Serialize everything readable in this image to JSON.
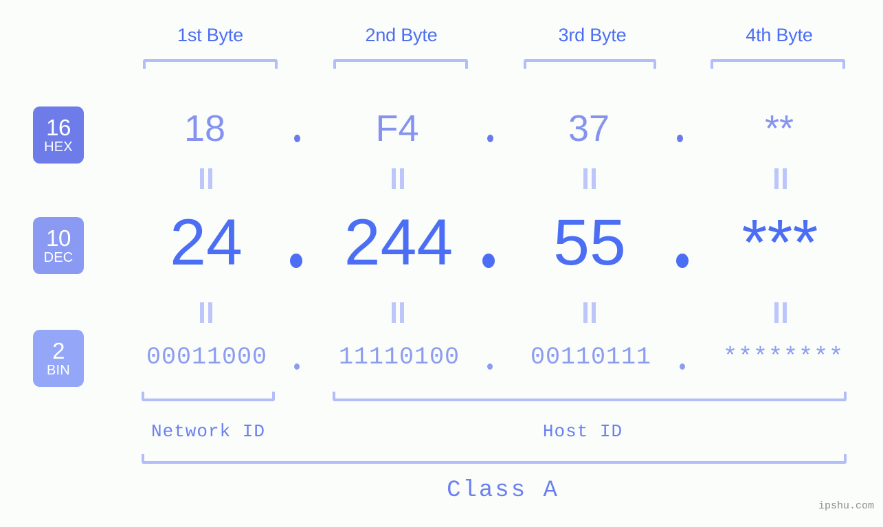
{
  "columns": [
    {
      "header": "1st Byte",
      "hex": "18",
      "dec": "24",
      "bin": "00011000"
    },
    {
      "header": "2nd Byte",
      "hex": "F4",
      "dec": "244",
      "bin": "11110100"
    },
    {
      "header": "3rd Byte",
      "hex": "37",
      "dec": "55",
      "bin": "00110111"
    },
    {
      "header": "4th Byte",
      "hex": "**",
      "dec": "***",
      "bin": "********"
    }
  ],
  "bases": [
    {
      "num": "16",
      "abbr": "HEX",
      "color": "#6d7ce8"
    },
    {
      "num": "10",
      "abbr": "DEC",
      "color": "#8a99f2"
    },
    {
      "num": "2",
      "abbr": "BIN",
      "color": "#93a6f8"
    }
  ],
  "separators": {
    "hex": ".",
    "dec": ".",
    "bin": "."
  },
  "connector": "=",
  "sections": {
    "network_id": "Network ID",
    "host_id": "Host ID",
    "class": "Class A"
  },
  "watermark": "ipshu.com",
  "colors": {
    "background": "#fafdfa",
    "accent": "#4c6ef5",
    "accent_light": "#8c9cf0",
    "bracket": "#b2bdfa"
  }
}
